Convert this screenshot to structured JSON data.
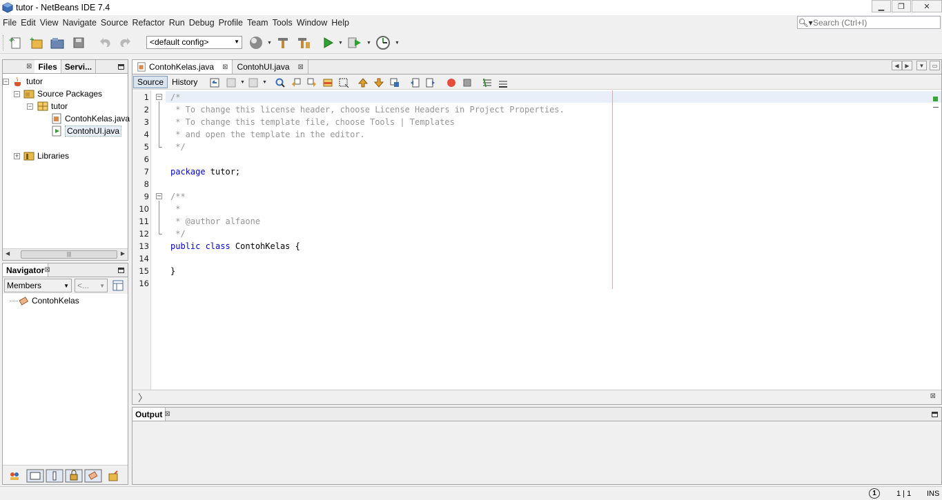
{
  "window": {
    "title": "tutor - NetBeans IDE 7.4",
    "controls": [
      "minimize",
      "restore",
      "close"
    ]
  },
  "menu": {
    "items": [
      "File",
      "Edit",
      "View",
      "Navigate",
      "Source",
      "Refactor",
      "Run",
      "Debug",
      "Profile",
      "Team",
      "Tools",
      "Window",
      "Help"
    ]
  },
  "search": {
    "placeholder": "Search (Ctrl+I)"
  },
  "toolbar": {
    "config": "<default config>"
  },
  "projects_panel": {
    "tabs": [
      "Files",
      "Servi..."
    ],
    "tree": {
      "project": "tutor",
      "source_packages": "Source Packages",
      "package": "tutor",
      "files": [
        "ContohKelas.java",
        "ContohUI.java"
      ],
      "libraries": "Libraries"
    }
  },
  "navigator": {
    "title": "Navigator",
    "filter": "Members",
    "secondary": "<...",
    "root": "ContohKelas"
  },
  "editor": {
    "tabs": [
      "ContohKelas.java",
      "ContohUI.java"
    ],
    "modes": [
      "Source",
      "History"
    ],
    "lines": [
      {
        "n": "1",
        "text": "/*"
      },
      {
        "n": "2",
        "text": " * To change this license header, choose License Headers in Project Properties."
      },
      {
        "n": "3",
        "text": " * To change this template file, choose Tools | Templates"
      },
      {
        "n": "4",
        "text": " * and open the template in the editor."
      },
      {
        "n": "5",
        "text": " */"
      },
      {
        "n": "6",
        "text": ""
      },
      {
        "n": "7",
        "kw": "package",
        "rest": " tutor;"
      },
      {
        "n": "8",
        "text": ""
      },
      {
        "n": "9",
        "text": "/**"
      },
      {
        "n": "10",
        "text": " *"
      },
      {
        "n": "11",
        "text": " * @author alfaone"
      },
      {
        "n": "12",
        "text": " */"
      },
      {
        "n": "13",
        "kw": "public class",
        "rest": " ContohKelas {"
      },
      {
        "n": "14",
        "text": ""
      },
      {
        "n": "15",
        "rest": "}"
      },
      {
        "n": "16",
        "text": ""
      }
    ]
  },
  "output": {
    "title": "Output"
  },
  "status": {
    "position": "1 | 1",
    "mode": "INS",
    "notification": "1"
  },
  "colors": {
    "keyword": "#0000e6",
    "comment": "#969696",
    "current_line": "#e9eff8"
  }
}
